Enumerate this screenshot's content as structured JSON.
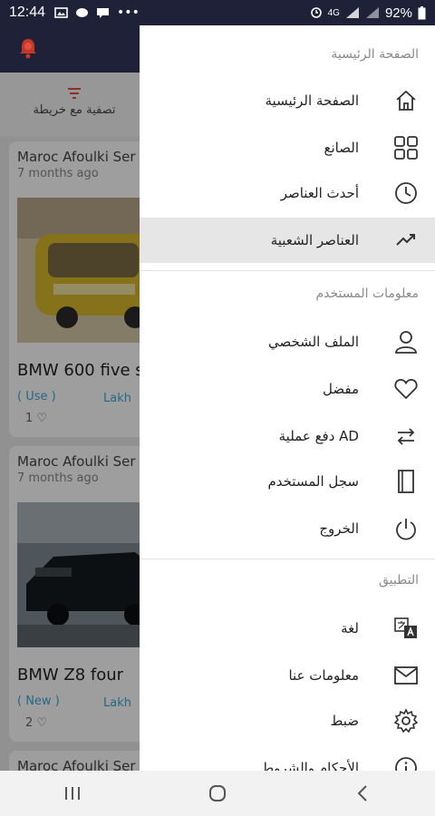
{
  "status_bar": {
    "time": "12:44",
    "battery": "92%"
  },
  "background": {
    "filter_label": "تصفية مع خريطة",
    "cards": [
      {
        "seller": "Maroc Afoulki Ser",
        "ago": "7 months ago",
        "title": "BMW 600 five s",
        "condition": "( Use )",
        "location": "Lakh",
        "likes": "1"
      },
      {
        "seller": "Maroc Afoulki Ser",
        "ago": "7 months ago",
        "title": "BMW Z8 four",
        "condition": "( New )",
        "location": "Lakh",
        "likes": "2"
      },
      {
        "seller": "Maroc Afoulki Ser"
      }
    ]
  },
  "drawer": {
    "sections": [
      {
        "header": "الصفحة الرئيسية",
        "items": [
          {
            "label": "الصفحة الرئيسية",
            "icon": "home-icon"
          },
          {
            "label": "الصانع",
            "icon": "grid-icon"
          },
          {
            "label": "أحدث العناصر",
            "icon": "clock-icon"
          },
          {
            "label": "العناصر الشعبية",
            "icon": "trending-icon",
            "active": true
          }
        ]
      },
      {
        "header": "معلومات المستخدم",
        "items": [
          {
            "label": "الملف الشخصي",
            "icon": "person-icon"
          },
          {
            "label": "مفضل",
            "icon": "heart-icon"
          },
          {
            "label": "دفع عملية AD",
            "icon": "swap-icon"
          },
          {
            "label": "سجل المستخدم",
            "icon": "book-icon"
          },
          {
            "label": "الخروج",
            "icon": "power-icon"
          }
        ]
      },
      {
        "header": "التطبيق",
        "items": [
          {
            "label": "لغة",
            "icon": "translate-icon"
          },
          {
            "label": "معلومات عنا",
            "icon": "mail-icon"
          },
          {
            "label": "ضبط",
            "icon": "settings-icon"
          },
          {
            "label": "الأحكام والشروط",
            "icon": "info-icon"
          }
        ]
      }
    ]
  },
  "colors": {
    "header_bg": "#1f2138",
    "active_row": "#e6e6e6",
    "link": "#3aa8d6"
  }
}
